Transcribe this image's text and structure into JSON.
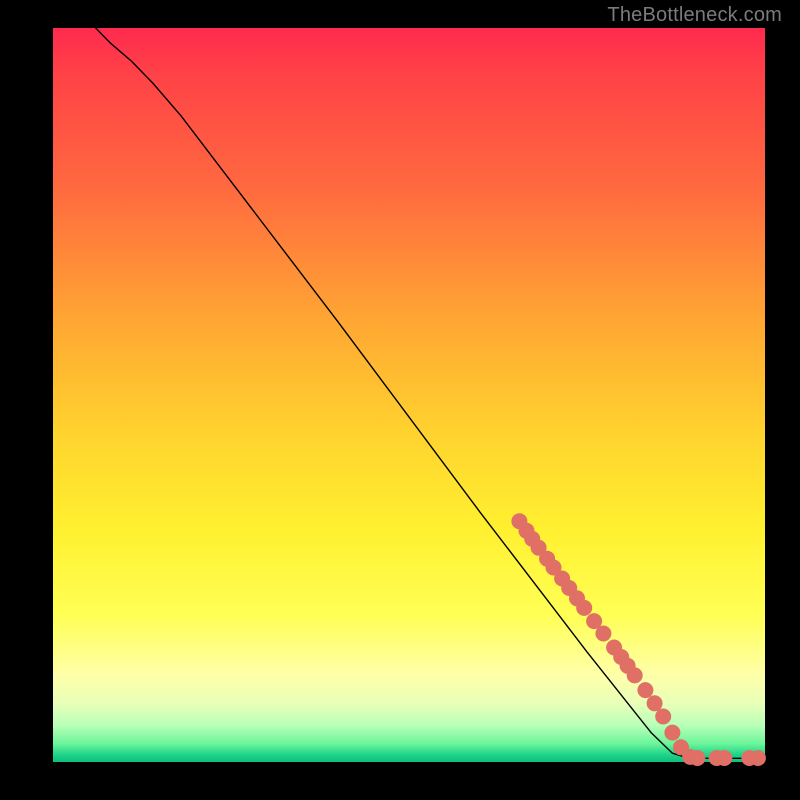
{
  "attribution": "TheBottleneck.com",
  "colors": {
    "marker": "#e07066",
    "curve": "#000000",
    "background": "#000000"
  },
  "chart_data": {
    "type": "line",
    "title": "",
    "xlabel": "",
    "ylabel": "",
    "xlim": [
      0,
      100
    ],
    "ylim": [
      0,
      100
    ],
    "curve_xy": [
      [
        6,
        100
      ],
      [
        8,
        98
      ],
      [
        11,
        95.5
      ],
      [
        14,
        92.5
      ],
      [
        18,
        88
      ],
      [
        40,
        60
      ],
      [
        60,
        34
      ],
      [
        75,
        15
      ],
      [
        84,
        4
      ],
      [
        87,
        1.2
      ],
      [
        89,
        0.6
      ],
      [
        92,
        0.5
      ],
      [
        96,
        0.5
      ],
      [
        100,
        0.5
      ]
    ],
    "markers_xy": [
      [
        65.5,
        32.8
      ],
      [
        66.5,
        31.5
      ],
      [
        67.3,
        30.4
      ],
      [
        68.2,
        29.2
      ],
      [
        69.4,
        27.7
      ],
      [
        70.3,
        26.5
      ],
      [
        71.5,
        25.0
      ],
      [
        72.5,
        23.7
      ],
      [
        73.6,
        22.3
      ],
      [
        74.6,
        21.0
      ],
      [
        76.0,
        19.2
      ],
      [
        77.3,
        17.5
      ],
      [
        78.8,
        15.6
      ],
      [
        79.8,
        14.3
      ],
      [
        80.7,
        13.1
      ],
      [
        81.7,
        11.8
      ],
      [
        83.2,
        9.8
      ],
      [
        84.5,
        8.0
      ],
      [
        85.7,
        6.2
      ],
      [
        87.0,
        4.0
      ],
      [
        88.2,
        2.0
      ],
      [
        89.5,
        0.7
      ],
      [
        90.5,
        0.55
      ],
      [
        93.2,
        0.55
      ],
      [
        94.3,
        0.55
      ],
      [
        97.8,
        0.55
      ],
      [
        99.0,
        0.55
      ]
    ],
    "marker_radius_px": 8
  }
}
